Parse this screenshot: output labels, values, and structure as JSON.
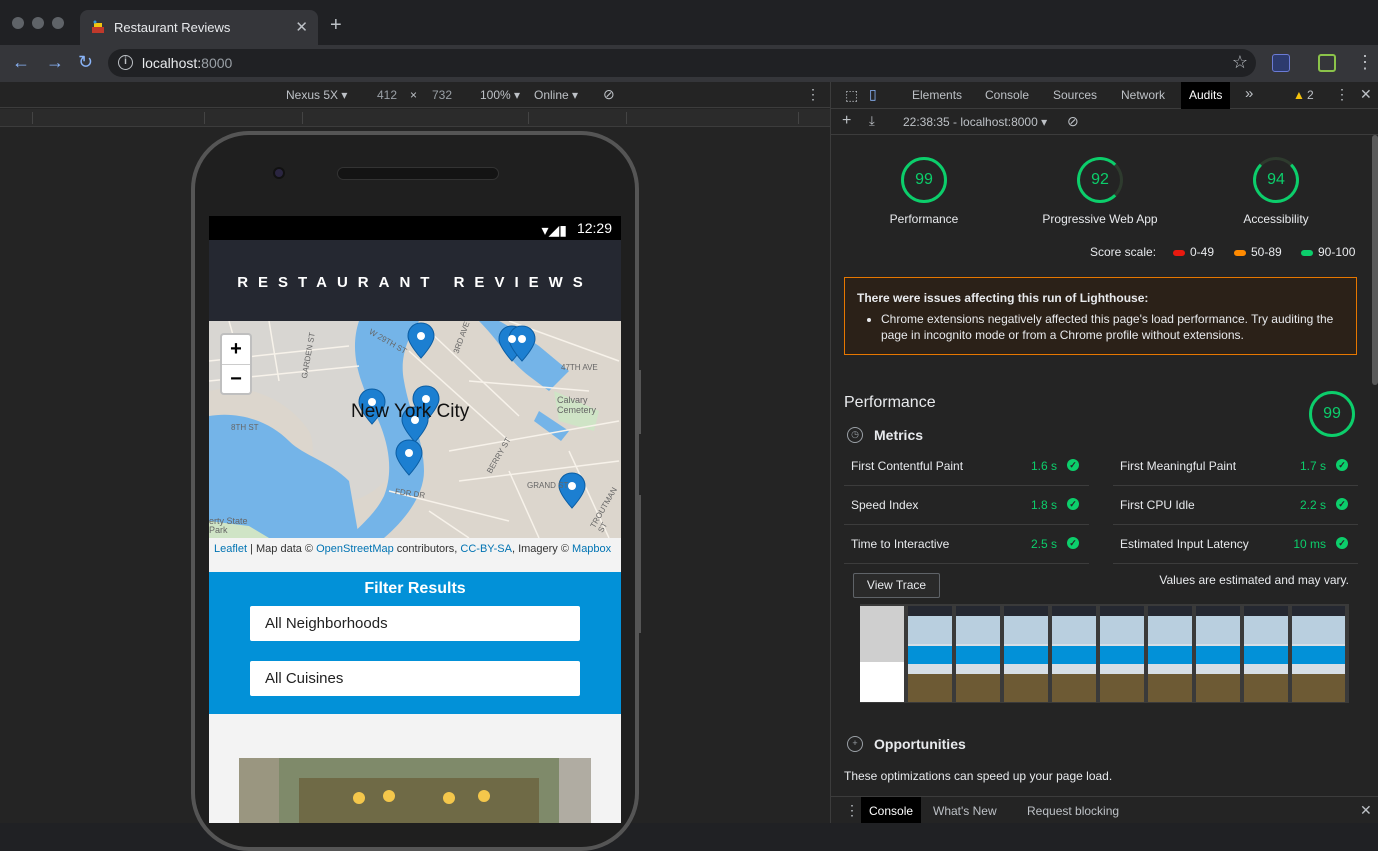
{
  "browser": {
    "tab_title": "Restaurant Reviews",
    "url_host": "localhost:",
    "url_port": "8000",
    "new_tab": "+",
    "close_tab": "✕"
  },
  "device_toolbar": {
    "device": "Nexus 5X ▾",
    "width": "412",
    "times": "×",
    "height": "732",
    "zoom": "100% ▾",
    "throttle": "Online ▾"
  },
  "page": {
    "status_time": "12:29",
    "header": "RESTAURANT REVIEWS",
    "zoom_in": "+",
    "zoom_out": "−",
    "map_city": "New York City",
    "map_labels": [
      "GARDEN ST",
      "W 29TH ST",
      "3RD AVE",
      "47TH AVE",
      "Calvary Cemetery",
      "8TH ST",
      "BERRY ST",
      "GRAND ST",
      "FDR DR",
      "erty State Park",
      "TROUTMAN ST"
    ],
    "attribution": {
      "leaflet": "Leaflet",
      "text1": " | Map data © ",
      "osm": "OpenStreetMap",
      "text2": " contributors, ",
      "license": "CC-BY-SA",
      "text3": ", Imagery © ",
      "mapbox": "Mapbox"
    },
    "filter_title": "Filter Results",
    "neighborhoods_select": "All Neighborhoods",
    "cuisines_select": "All Cuisines"
  },
  "devtools": {
    "tabs": [
      "Elements",
      "Console",
      "Sources",
      "Network",
      "Audits"
    ],
    "more": "»",
    "warnings_count": "2",
    "report_selector": "22:38:35 - localhost:8000 ▾",
    "gauges": [
      {
        "label": "Performance",
        "score": "99"
      },
      {
        "label": "Progressive Web App",
        "score": "92"
      },
      {
        "label": "Accessibility",
        "score": "94"
      }
    ],
    "score_scale_label": "Score scale:",
    "scale": [
      {
        "range": "0-49",
        "color": "#e8190f"
      },
      {
        "range": "50-89",
        "color": "#ff8a00"
      },
      {
        "range": "90-100",
        "color": "#0cce6b"
      }
    ],
    "warning_title": "There were issues affecting this run of Lighthouse:",
    "warning_item": "Chrome extensions negatively affected this page's load performance. Try auditing the page in incognito mode or from a Chrome profile without extensions.",
    "performance_title": "Performance",
    "performance_score": "99",
    "metrics_title": "Metrics",
    "metrics": [
      {
        "name": "First Contentful Paint",
        "value": "1.6 s"
      },
      {
        "name": "First Meaningful Paint",
        "value": "1.7 s"
      },
      {
        "name": "Speed Index",
        "value": "1.8 s"
      },
      {
        "name": "First CPU Idle",
        "value": "2.2 s"
      },
      {
        "name": "Time to Interactive",
        "value": "2.5 s"
      },
      {
        "name": "Estimated Input Latency",
        "value": "10 ms"
      }
    ],
    "view_trace": "View Trace",
    "estimated_note": "Values are estimated and may vary.",
    "opportunities_title": "Opportunities",
    "opportunities_desc": "These optimizations can speed up your page load.",
    "drawer_tabs": [
      "Console",
      "What's New",
      "Request blocking"
    ]
  }
}
